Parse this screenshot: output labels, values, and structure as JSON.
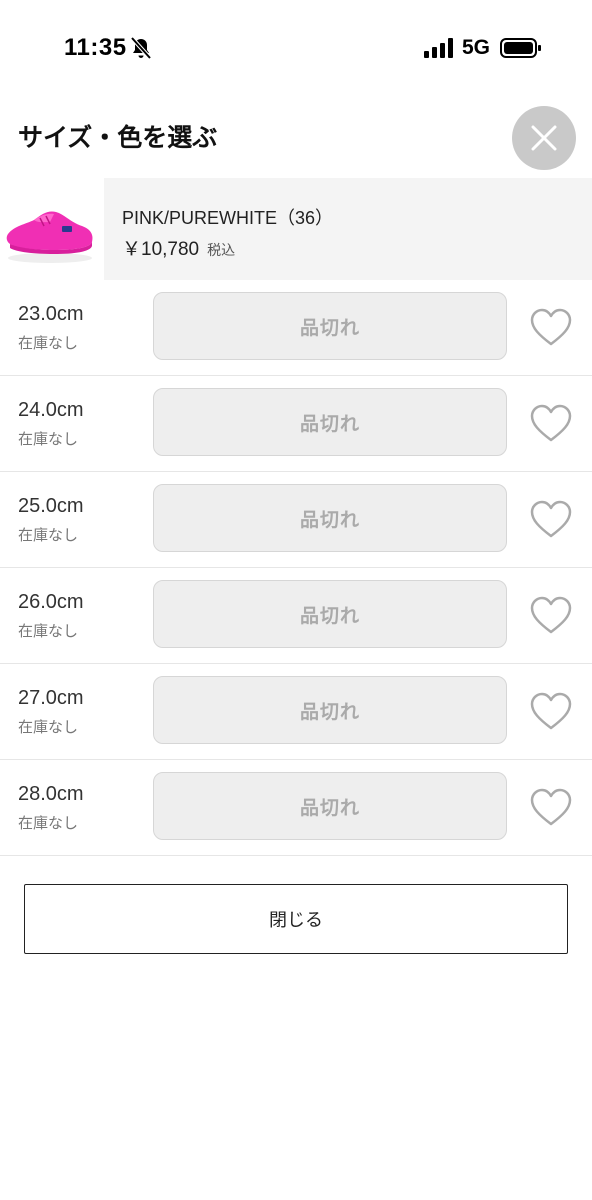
{
  "status_bar": {
    "time": "11:35",
    "network": "5G",
    "icons": [
      "bell-muted-icon",
      "signal-bars-icon",
      "battery-icon"
    ]
  },
  "header": {
    "title": "サイズ・色を選ぶ",
    "close_icon": "close-icon"
  },
  "product": {
    "variant": "PINK/PUREWHITE（36）",
    "price": "￥10,780",
    "tax_label": "税込",
    "accent_color": "#f02fb4"
  },
  "sizes": [
    {
      "size": "23.0cm",
      "stock": "在庫なし",
      "button": "品切れ"
    },
    {
      "size": "24.0cm",
      "stock": "在庫なし",
      "button": "品切れ"
    },
    {
      "size": "25.0cm",
      "stock": "在庫なし",
      "button": "品切れ"
    },
    {
      "size": "26.0cm",
      "stock": "在庫なし",
      "button": "品切れ"
    },
    {
      "size": "27.0cm",
      "stock": "在庫なし",
      "button": "品切れ"
    },
    {
      "size": "28.0cm",
      "stock": "在庫なし",
      "button": "品切れ"
    }
  ],
  "footer": {
    "close_label": "閉じる"
  }
}
